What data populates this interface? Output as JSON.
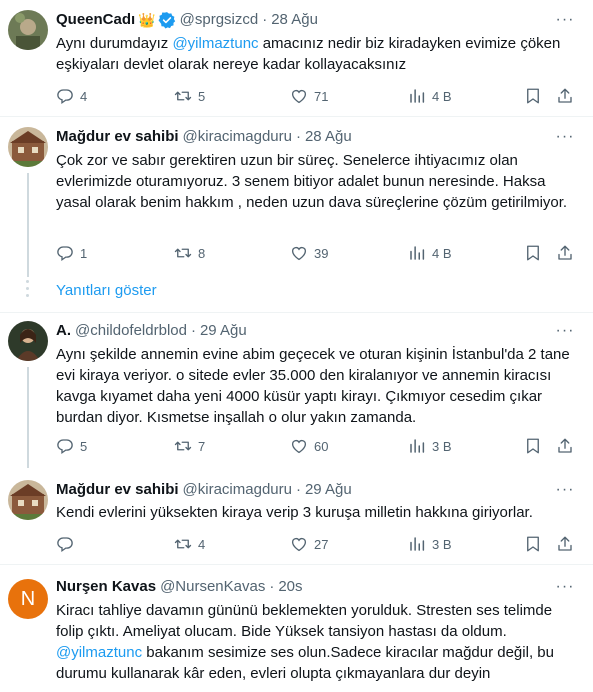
{
  "tweets": [
    {
      "name": "QueenCadı",
      "handle": "@sprgsizcd",
      "time": "28 Ağu",
      "body_parts": [
        "Aynı durumdayız ",
        "@yilmaztunc",
        "  amacınız nedir biz kiradayken evimize çöken eşkiyaları devlet olarak nereye kadar kollayacaksınız"
      ],
      "replies": "4",
      "retweets": "5",
      "likes": "71",
      "views": "4 B"
    },
    {
      "name": "Mağdur ev sahibi",
      "handle": "@kiracimagduru",
      "time": "28 Ağu",
      "body": "Çok zor ve sabır gerektiren uzun bir süreç. Senelerce ihtiyacımız olan evlerimizde oturamıyoruz. 3 senem bitiyor adalet bunun neresinde. Haksa yasal olarak benim hakkım , neden uzun dava süreçlerine çözüm getirilmiyor.",
      "replies": "1",
      "retweets": "8",
      "likes": "39",
      "views": "4 B"
    },
    {
      "name": "A.",
      "handle": "@childofeldrblod",
      "time": "29 Ağu",
      "body": "Aynı şekilde annemin evine abim geçecek ve oturan kişinin İstanbul'da 2 tane evi kiraya veriyor. o sitede evler 35.000 den kiralanıyor ve annemin kiracısı kavga kıyamet daha yeni 4000 küsür yaptı kirayı. Çıkmıyor cesedim çıkar burdan diyor. Kısmetse inşallah o olur yakın zamanda.",
      "replies": "5",
      "retweets": "7",
      "likes": "60",
      "views": "3 B"
    },
    {
      "name": "Mağdur ev sahibi",
      "handle": "@kiracimagduru",
      "time": "29 Ağu",
      "body": "Kendi evlerini yüksekten kiraya verip 3 kuruşa milletin hakkına giriyorlar.",
      "replies": "",
      "retweets": "4",
      "likes": "27",
      "views": "3 B"
    },
    {
      "name": "Nurşen Kavas",
      "handle": "@NursenKavas",
      "time": "20s",
      "avatar_letter": "N",
      "body_a": "Kiracı tahliye davamın gününü beklemekten yorulduk. Stresten ses telimde folip çıktı. Ameliyat  olucam. Bide Yüksek tansiyon hastası da oldum.",
      "mention": "@yilmaztunc",
      "body_b": "  bakanım sesimize ses olun.Sadece kiracılar mağdur değil, bu durumu kullanarak kâr eden, evleri olupta çıkmayanlara dur deyin"
    }
  ],
  "show_replies_label": "Yanıtları göster",
  "more_glyph": "···",
  "icons": [
    "reply-icon",
    "retweet-icon",
    "like-icon",
    "views-icon",
    "bookmark-icon",
    "share-icon",
    "verified-icon",
    "crown-icon"
  ],
  "colors": {
    "accent": "#1d9bf0",
    "muted": "#536471",
    "text": "#0f1419",
    "avatar_n": "#e8720c"
  }
}
